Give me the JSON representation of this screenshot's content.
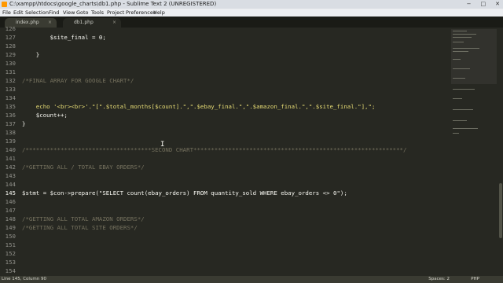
{
  "window": {
    "title": "C:\\xampp\\htdocs\\google_charts\\db1.php - Sublime Text 2 (UNREGISTERED)",
    "controls": {
      "minimize": "−",
      "maximize": "□",
      "close": "✕"
    }
  },
  "menu": {
    "items": [
      "File",
      "Edit",
      "Selection",
      "Find",
      "View",
      "Goto",
      "Tools",
      "Project",
      "Preferences",
      "Help"
    ]
  },
  "tabs": [
    {
      "label": "index.php",
      "close": "×"
    },
    {
      "label": "db1.php",
      "close": "×"
    }
  ],
  "editor": {
    "active_line": "145",
    "lines": [
      {
        "n": "126",
        "text": ""
      },
      {
        "n": "127",
        "text": "        $site_final = 0;"
      },
      {
        "n": "128",
        "text": ""
      },
      {
        "n": "129",
        "text": "    }"
      },
      {
        "n": "130",
        "text": ""
      },
      {
        "n": "131",
        "text": ""
      },
      {
        "n": "132",
        "text": "/*FINAL ARRAY FOR GOOGLE CHART*/"
      },
      {
        "n": "133",
        "text": ""
      },
      {
        "n": "134",
        "text": ""
      },
      {
        "n": "135",
        "text": "    echo '<br><br>'.\"[\".$total_months[$count].\",\".$ebay_final.\",\".$amazon_final.\",\".$site_final.\"],\";"
      },
      {
        "n": "136",
        "text": "    $count++;"
      },
      {
        "n": "137",
        "text": "}"
      },
      {
        "n": "138",
        "text": ""
      },
      {
        "n": "139",
        "text": ""
      },
      {
        "n": "140",
        "text": "/************************************SECOND CHART************************************************************/"
      },
      {
        "n": "141",
        "text": ""
      },
      {
        "n": "142",
        "text": "/*GETTING ALL / TOTAL EBAY ORDERS*/"
      },
      {
        "n": "143",
        "text": ""
      },
      {
        "n": "144",
        "text": ""
      },
      {
        "n": "145",
        "text": "$stmt = $con->prepare(\"SELECT count(ebay_orders) FROM quantity_sold WHERE ebay_orders <> 0\");"
      },
      {
        "n": "146",
        "text": ""
      },
      {
        "n": "147",
        "text": ""
      },
      {
        "n": "148",
        "text": "/*GETTING ALL TOTAL AMAZON ORDERS*/"
      },
      {
        "n": "149",
        "text": "/*GETTING ALL TOTAL SITE ORDERS*/"
      },
      {
        "n": "150",
        "text": ""
      },
      {
        "n": "151",
        "text": ""
      },
      {
        "n": "152",
        "text": ""
      },
      {
        "n": "153",
        "text": ""
      },
      {
        "n": "154",
        "text": ""
      },
      {
        "n": "155",
        "text": ""
      },
      {
        "n": "156",
        "text": ""
      },
      {
        "n": "157",
        "text": ""
      },
      {
        "n": "158",
        "text": ""
      },
      {
        "n": "159",
        "text": ""
      }
    ]
  },
  "status": {
    "position": "Line 145, Column 90",
    "spaces": "Spaces: 2",
    "syntax": "PHP"
  },
  "colors": {
    "background": "#272822",
    "comment": "#75715e",
    "string": "#e6db74",
    "keyword": "#f92672",
    "number": "#ae81ff"
  }
}
